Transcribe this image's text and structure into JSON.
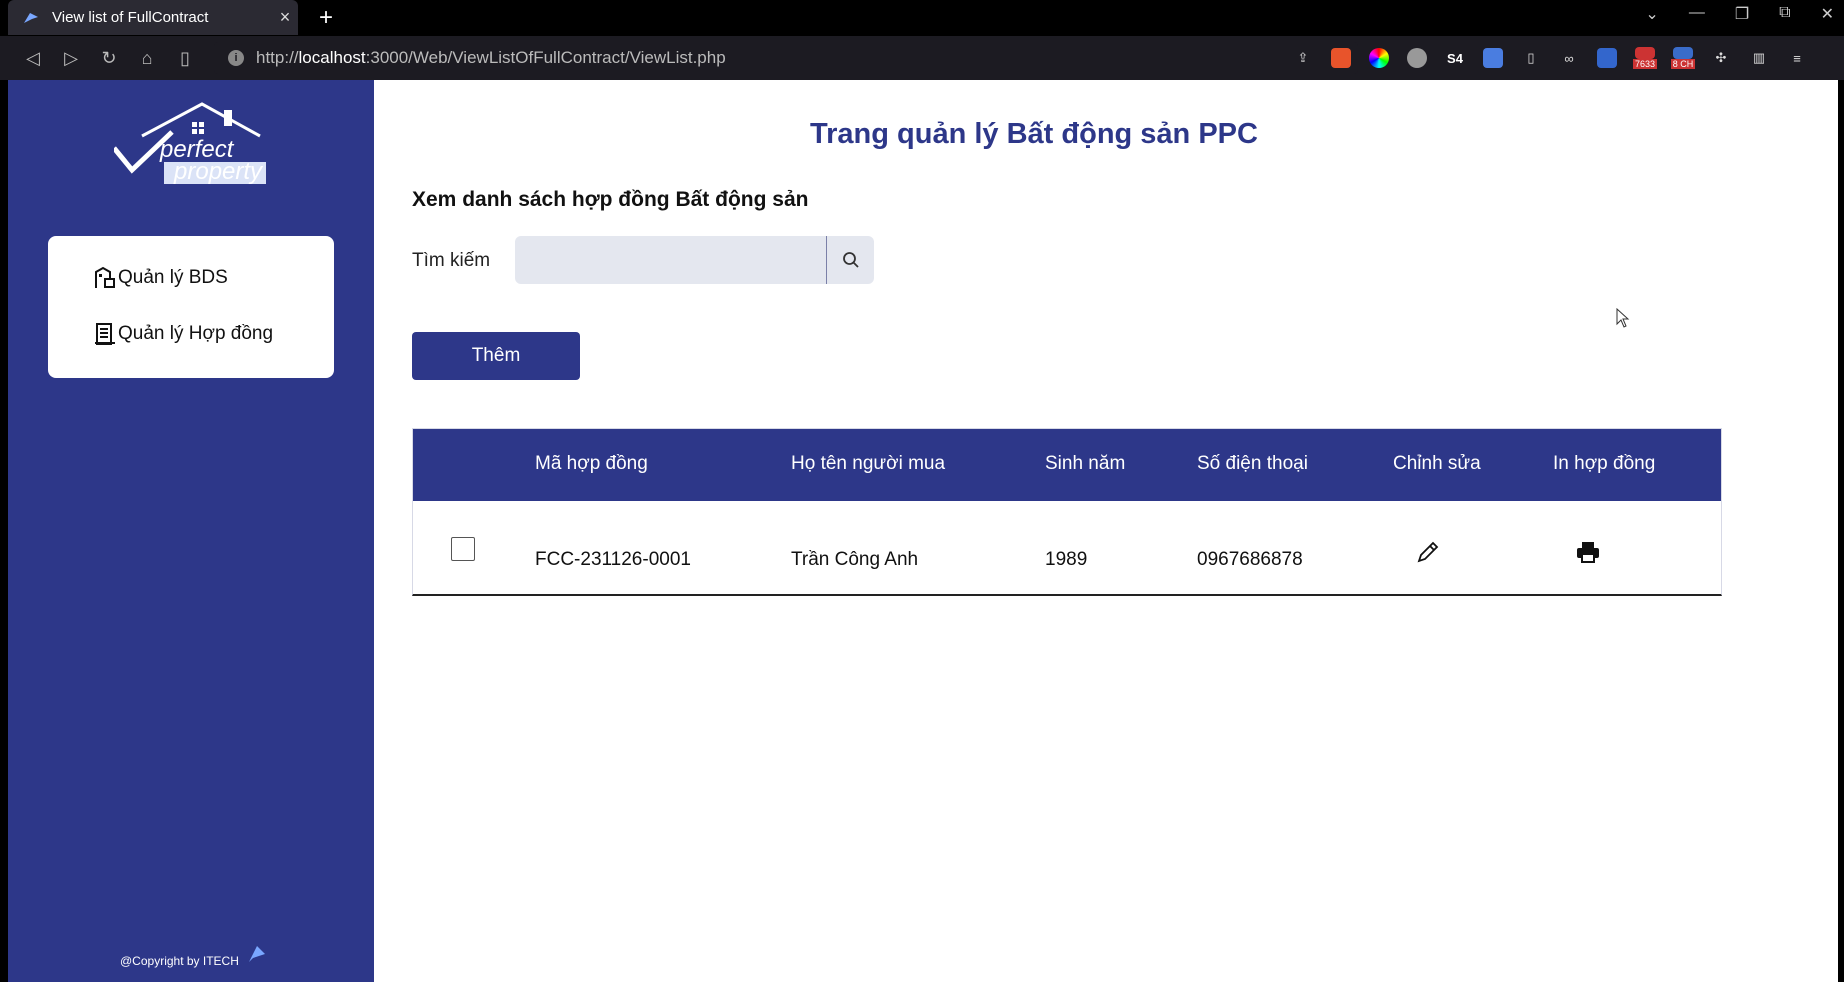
{
  "browser": {
    "tab_title": "View list of FullContract",
    "url_prefix": "http://",
    "url_host": "localhost",
    "url_path": ":3000/Web/ViewListOfFullContract/ViewList.php",
    "ext_badge_1": "7633",
    "ext_badge_2": "8 CH"
  },
  "sidebar": {
    "logo_text_1": "perfect",
    "logo_text_2": "property",
    "items": [
      {
        "label": "Quản lý BDS"
      },
      {
        "label": "Quản lý Hợp đồng"
      }
    ],
    "copyright": "@Copyright by ITECH"
  },
  "main": {
    "page_title": "Trang quản lý Bất động sản PPC",
    "subtitle": "Xem danh sách hợp đồng Bất động sản",
    "search_label": "Tìm kiếm",
    "search_value": "",
    "add_label": "Thêm"
  },
  "table": {
    "headers": [
      "Mã hợp đồng",
      "Họ tên người mua",
      "Sinh năm",
      "Số điện thoại",
      "Chỉnh sửa",
      "In hợp đồng"
    ],
    "rows": [
      {
        "code": "FCC-231126-0001",
        "name": "Trần Công Anh",
        "year": "1989",
        "phone": "0967686878"
      }
    ]
  },
  "colors": {
    "brand": "#2d3789",
    "search_bg": "#e4e7ef"
  }
}
